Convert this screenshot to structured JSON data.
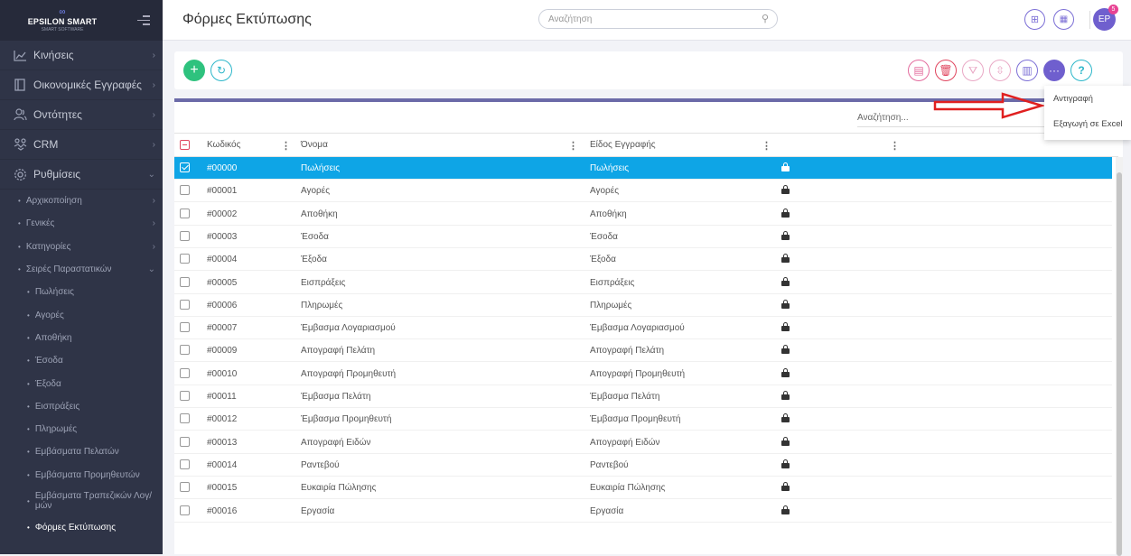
{
  "sidebar": {
    "logo": {
      "mark": "∞",
      "name": "EPSILON SMART",
      "sub": "SMART SOFTWARE"
    },
    "main": [
      {
        "label": "Κινήσεις",
        "icon": "chart-icon"
      },
      {
        "label": "Οικονομικές Εγγραφές",
        "icon": "book-icon"
      },
      {
        "label": "Οντότητες",
        "icon": "users-icon"
      },
      {
        "label": "CRM",
        "icon": "handshake-icon"
      },
      {
        "label": "Ρυθμίσεις",
        "icon": "gear-icon"
      }
    ],
    "sub": [
      "Αρχικοποίηση",
      "Γενικές",
      "Κατηγορίες",
      "Σειρές Παραστατικών"
    ],
    "sub2": [
      "Πωλήσεις",
      "Αγορές",
      "Αποθήκη",
      "Έσοδα",
      "Έξοδα",
      "Εισπράξεις",
      "Πληρωμές",
      "Εμβάσματα Πελατών",
      "Εμβάσματα Προμηθευτών"
    ],
    "sub2_two_line": {
      "line1": "Εμβάσματα Τραπεζικών Λογ/",
      "line2": "μών"
    },
    "active": "Φόρμες Εκτύπωσης"
  },
  "header": {
    "title": "Φόρμες Εκτύπωσης",
    "search_placeholder": "Αναζήτηση",
    "avatar": "EP",
    "badge": "5"
  },
  "grid": {
    "search_placeholder": "Αναζήτηση...",
    "columns": [
      "Κωδικός",
      "Όνομα",
      "Είδος Εγγραφής"
    ],
    "rows": [
      {
        "code": "#00000",
        "name": "Πωλήσεις",
        "type": "Πωλήσεις",
        "selected": true
      },
      {
        "code": "#00001",
        "name": "Αγορές",
        "type": "Αγορές"
      },
      {
        "code": "#00002",
        "name": "Αποθήκη",
        "type": "Αποθήκη"
      },
      {
        "code": "#00003",
        "name": "Έσοδα",
        "type": "Έσοδα"
      },
      {
        "code": "#00004",
        "name": "Έξοδα",
        "type": "Έξοδα"
      },
      {
        "code": "#00005",
        "name": "Εισπράξεις",
        "type": "Εισπράξεις"
      },
      {
        "code": "#00006",
        "name": "Πληρωμές",
        "type": "Πληρωμές"
      },
      {
        "code": "#00007",
        "name": "Έμβασμα Λογαριασμού",
        "type": "Έμβασμα Λογαριασμού"
      },
      {
        "code": "#00009",
        "name": "Απογραφή Πελάτη",
        "type": "Απογραφή Πελάτη"
      },
      {
        "code": "#00010",
        "name": "Απογραφή Προμηθευτή",
        "type": "Απογραφή Προμηθευτή"
      },
      {
        "code": "#00011",
        "name": "Έμβασμα Πελάτη",
        "type": "Έμβασμα Πελάτη"
      },
      {
        "code": "#00012",
        "name": "Έμβασμα Προμηθευτή",
        "type": "Έμβασμα Προμηθευτή"
      },
      {
        "code": "#00013",
        "name": "Απογραφή Ειδών",
        "type": "Απογραφή Ειδών"
      },
      {
        "code": "#00014",
        "name": "Ραντεβού",
        "type": "Ραντεβού"
      },
      {
        "code": "#00015",
        "name": "Ευκαιρία Πώλησης",
        "type": "Ευκαιρία Πώλησης"
      },
      {
        "code": "#00016",
        "name": "Εργασία",
        "type": "Εργασία"
      }
    ]
  },
  "dropdown": {
    "copy": "Αντιγραφή",
    "export": "Εξαγωγή σε Excel"
  },
  "colors": {
    "accent": "#7c6fd6",
    "selected": "#0ea5e6",
    "sidebar": "#2f3447",
    "danger": "#e0455e",
    "success": "#2ec27e"
  }
}
